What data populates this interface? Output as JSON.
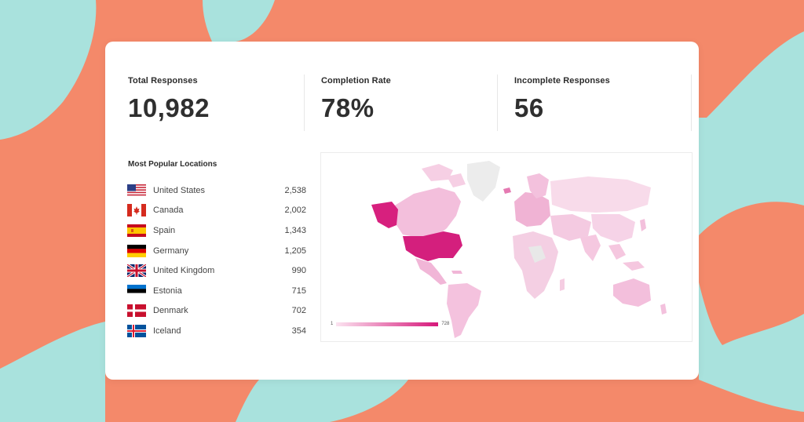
{
  "colors": {
    "background": "#f4896a",
    "blob": "#a9e2dd",
    "card": "#ffffff",
    "map_scale_low": "#fbe3f0",
    "map_scale_high": "#d6187a"
  },
  "stats": [
    {
      "label": "Total Responses",
      "value": "10,982"
    },
    {
      "label": "Completion Rate",
      "value": "78%"
    },
    {
      "label": "Incomplete Responses",
      "value": "56"
    }
  ],
  "locations": {
    "title": "Most Popular Locations",
    "items": [
      {
        "flag": "flag-us",
        "name": "United States",
        "count": "2,538"
      },
      {
        "flag": "flag-ca",
        "name": "Canada",
        "count": "2,002"
      },
      {
        "flag": "flag-es",
        "name": "Spain",
        "count": "1,343"
      },
      {
        "flag": "flag-de",
        "name": "Germany",
        "count": "1,205"
      },
      {
        "flag": "flag-gb",
        "name": "United Kingdom",
        "count": "990"
      },
      {
        "flag": "flag-ee",
        "name": "Estonia",
        "count": "715"
      },
      {
        "flag": "flag-dk",
        "name": "Denmark",
        "count": "702"
      },
      {
        "flag": "flag-is",
        "name": "Iceland",
        "count": "354"
      }
    ]
  },
  "map": {
    "legend_min": "1",
    "legend_max": "728"
  }
}
